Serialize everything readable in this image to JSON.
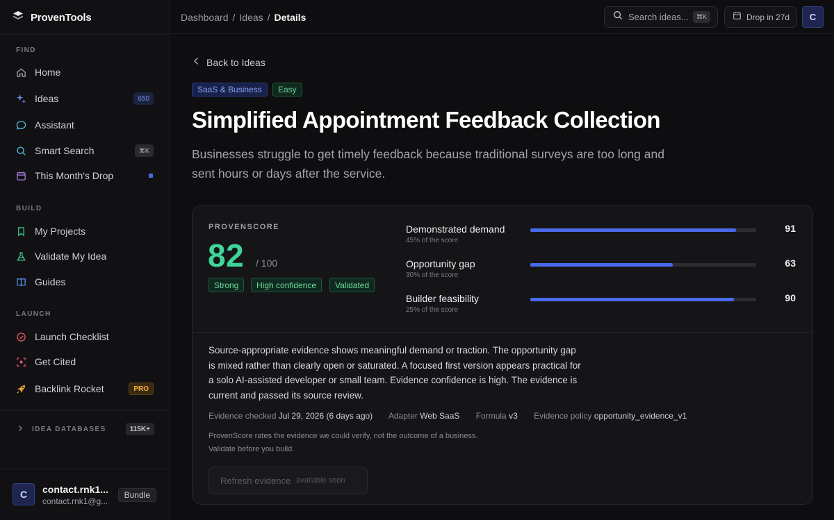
{
  "app": {
    "name": "ProvenTools"
  },
  "sidebar": {
    "sections": {
      "find": "FIND",
      "build": "BUILD",
      "launch": "LAUNCH"
    },
    "items": [
      {
        "label": "Home",
        "icon": "home-icon"
      },
      {
        "label": "Ideas",
        "icon": "sparkle-icon",
        "badge": "650"
      },
      {
        "label": "Assistant",
        "icon": "chat-bubble-icon"
      },
      {
        "label": "Smart Search",
        "icon": "search-icon",
        "badge": "⌘K"
      },
      {
        "label": "This Month's Drop",
        "icon": "calendar-icon"
      },
      {
        "label": "My Projects",
        "icon": "bookmark-icon"
      },
      {
        "label": "Validate My Idea",
        "icon": "flask-icon"
      },
      {
        "label": "Guides",
        "icon": "book-icon"
      },
      {
        "label": "Launch Checklist",
        "icon": "check-circle-icon"
      },
      {
        "label": "Get Cited",
        "icon": "target-icon"
      },
      {
        "label": "Backlink Rocket",
        "icon": "rocket-icon",
        "badge": "PRO"
      }
    ],
    "idea_databases": {
      "label": "IDEA DATABASES",
      "badge": "115K+"
    },
    "user": {
      "initial": "C",
      "name": "contact.rnk1...",
      "email": "contact.rnk1@g...",
      "plan": "Bundle"
    }
  },
  "topbar": {
    "breadcrumbs": [
      "Dashboard",
      "/",
      "Ideas",
      "/",
      "Details"
    ],
    "search_placeholder": "Search ideas...",
    "search_shortcut": "⌘K",
    "drop_label": "Drop in 27d",
    "avatar_initial": "C"
  },
  "idea": {
    "back_label": "Back to Ideas",
    "tags": [
      "SaaS & Business",
      "Easy"
    ],
    "title": "Simplified Appointment Feedback Collection",
    "description": "Businesses struggle to get timely feedback because traditional surveys are too long and sent hours or days after the service."
  },
  "score": {
    "label": "PROVENSCORE",
    "value": "82",
    "max": "/ 100",
    "chips": [
      "Strong",
      "High confidence",
      "Validated"
    ],
    "metrics": [
      {
        "name": "Demonstrated demand",
        "weight": "45% of the score",
        "value": "91"
      },
      {
        "name": "Opportunity gap",
        "weight": "30% of the score",
        "value": "63"
      },
      {
        "name": "Builder feasibility",
        "weight": "25% of the score",
        "value": "90"
      }
    ],
    "accent_color": "#3ed59a",
    "bar_color": "#4a69ea",
    "evidence_text": "Source-appropriate evidence shows meaningful demand or traction. The opportunity gap is mixed rather than clearly open or saturated. A focused first version appears practical for a solo AI-assisted developer or small team. Evidence confidence is high. The evidence is current and passed its source review.",
    "meta": {
      "checked_label": "Evidence checked",
      "checked_value": "Jul 29, 2026 (6 days ago)",
      "adapter_label": "Adapter",
      "adapter_value": "Web SaaS",
      "formula_label": "Formula",
      "formula_value": "v3",
      "policy_label": "Evidence policy",
      "policy_value": "opportunity_evidence_v1"
    },
    "note_line1": "ProvenScore rates the evidence we could verify, not the outcome of a business.",
    "note_line2": "Validate before you build.",
    "refresh_label": "Refresh evidence",
    "refresh_sub": "available soon"
  }
}
